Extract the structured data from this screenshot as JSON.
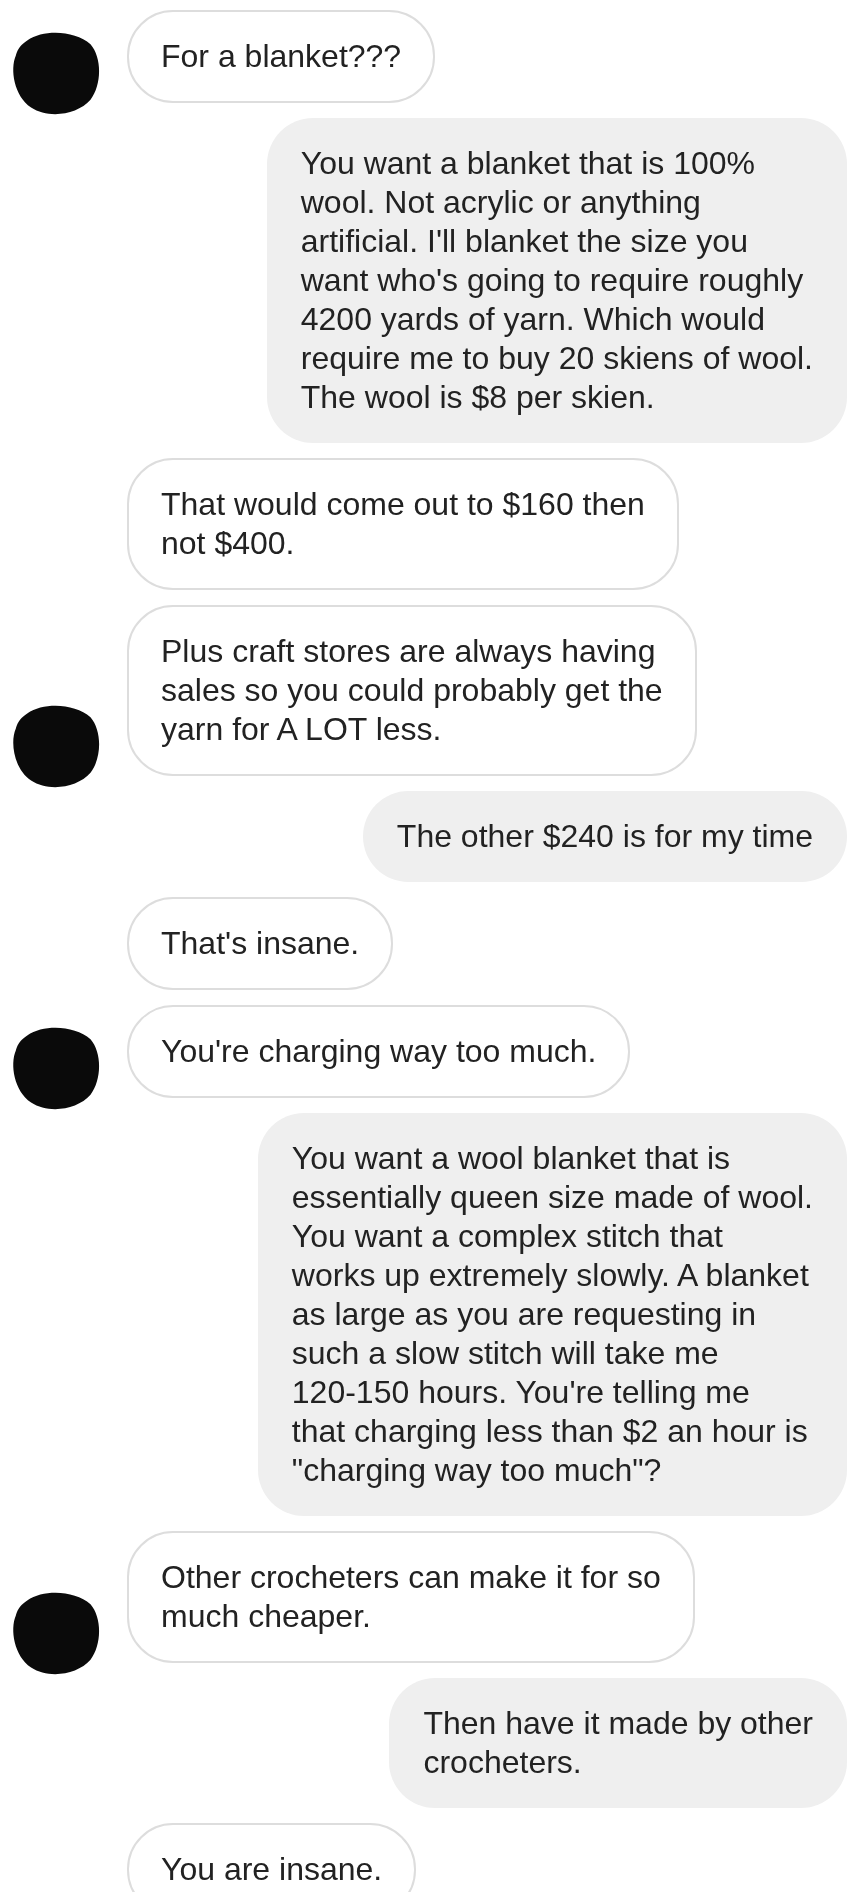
{
  "messages": [
    {
      "kind": "incoming",
      "avatar": true,
      "text": "For a blanket???"
    },
    {
      "kind": "outgoing",
      "avatar": false,
      "text": "You want a blanket that is 100%\nwool. Not acrylic or anything\nartificial. I'll blanket the size you\nwant who's going to require roughly\n4200 yards of yarn. Which would\nrequire me to buy 20 skiens of wool.\nThe wool is $8 per skien."
    },
    {
      "kind": "incoming",
      "avatar": false,
      "text": "That would come out to $160 then\nnot $400."
    },
    {
      "kind": "incoming",
      "avatar": true,
      "text": "Plus craft stores are always having\nsales so you could probably get the\nyarn for A LOT less."
    },
    {
      "kind": "outgoing",
      "avatar": false,
      "text": "The other $240 is for my time"
    },
    {
      "kind": "incoming",
      "avatar": false,
      "text": "That's insane."
    },
    {
      "kind": "incoming",
      "avatar": true,
      "text": "You're charging way too much."
    },
    {
      "kind": "outgoing",
      "avatar": false,
      "text": "You want a wool blanket that is\nessentially queen size made of wool.\nYou want a complex stitch that\nworks up extremely slowly. A blanket\nas large as you are requesting in\nsuch a slow stitch will take me\n120-150 hours. You're telling me\nthat charging less than $2 an hour is\n\"charging way too much\"?"
    },
    {
      "kind": "incoming",
      "avatar": true,
      "text": "Other crocheters can make it for so\nmuch cheaper."
    },
    {
      "kind": "outgoing",
      "avatar": false,
      "text": "Then have it made by other\ncrocheters."
    },
    {
      "kind": "incoming",
      "avatar": false,
      "text": "You are insane."
    }
  ]
}
